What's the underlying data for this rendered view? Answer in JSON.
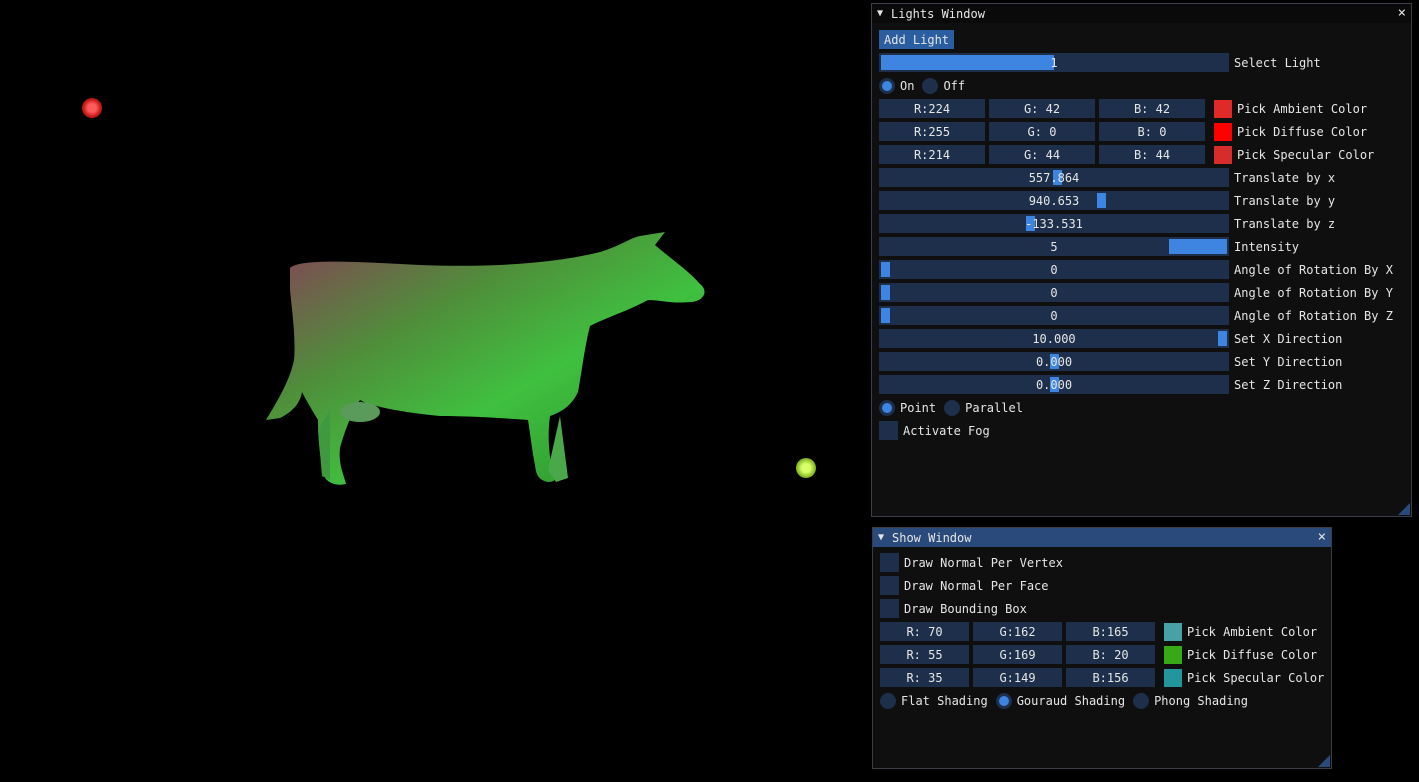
{
  "colors": {
    "accent": "#3d85e0",
    "frame": "#1d2f4a",
    "light_marker_red": "#d42020",
    "light_marker_yellow": "#8fc22a",
    "cow_green": "#3aa83a"
  },
  "lights_window": {
    "title": "Lights Window",
    "close_glyph": "×",
    "add_light_label": "Add Light",
    "select_light": {
      "value": "1",
      "label": "Select Light",
      "fraction": 0.5
    },
    "on_label": "On",
    "off_label": "Off",
    "on_selected": true,
    "ambient": {
      "r": "R:224",
      "g": "G: 42",
      "b": "B: 42",
      "swatch": "#e02a2a",
      "label": "Pick Ambient Color"
    },
    "diffuse": {
      "r": "R:255",
      "g": "G:  0",
      "b": "B:  0",
      "swatch": "#ff0000",
      "label": "Pick Diffuse Color"
    },
    "specular": {
      "r": "R:214",
      "g": "G: 44",
      "b": "B: 44",
      "swatch": "#d62c2c",
      "label": "Pick Specular Color"
    },
    "sliders": [
      {
        "value": "557.864",
        "label": "Translate by x",
        "fraction": 0.51
      },
      {
        "value": "940.653",
        "label": "Translate by y",
        "fraction": 0.64
      },
      {
        "value": "-133.531",
        "label": "Translate by z",
        "fraction": 0.43
      },
      {
        "value": "5",
        "label": "Intensity",
        "fraction": 0.83
      },
      {
        "value": "0",
        "label": "Angle of Rotation By X",
        "fraction": 0.0
      },
      {
        "value": "0",
        "label": "Angle of Rotation By Y",
        "fraction": 0.0
      },
      {
        "value": "0",
        "label": "Angle of Rotation By Z",
        "fraction": 0.0
      },
      {
        "value": "10.000",
        "label": "Set X Direction",
        "fraction": 1.0
      },
      {
        "value": "0.000",
        "label": "Set Y Direction",
        "fraction": 0.5
      },
      {
        "value": "0.000",
        "label": "Set Z Direction",
        "fraction": 0.5
      }
    ],
    "point_label": "Point",
    "parallel_label": "Parallel",
    "point_selected": true,
    "fog_label": "Activate Fog"
  },
  "show_window": {
    "title": "Show Window",
    "close_glyph": "×",
    "draw_normal_vertex": "Draw Normal Per Vertex",
    "draw_normal_face": "Draw Normal Per Face",
    "draw_bounding_box": "Draw Bounding Box",
    "ambient": {
      "r": "R: 70",
      "g": "G:162",
      "b": "B:165",
      "swatch": "#46a2a5",
      "label": "Pick Ambient Color"
    },
    "diffuse": {
      "r": "R: 55",
      "g": "G:169",
      "b": "B: 20",
      "swatch": "#37a914",
      "label": "Pick Diffuse Color"
    },
    "specular": {
      "r": "R: 35",
      "g": "G:149",
      "b": "B:156",
      "swatch": "#23959c",
      "label": "Pick Specular Color"
    },
    "shading": {
      "flat": "Flat Shading",
      "gouraud": "Gouraud Shading",
      "phong": "Phong Shading",
      "selected": "gouraud"
    }
  }
}
